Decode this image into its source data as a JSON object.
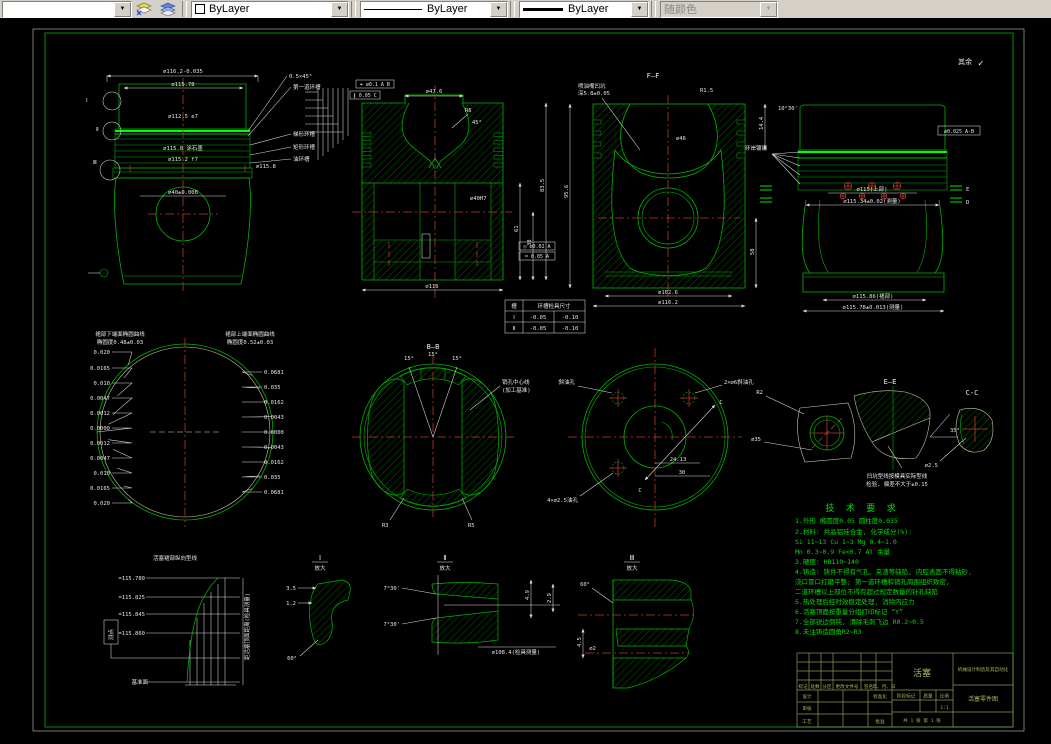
{
  "toolbar": {
    "color": {
      "value": "ByLayer"
    },
    "linetype": {
      "value": "ByLayer"
    },
    "lineweight": {
      "value": "ByLayer"
    },
    "plotstyle": {
      "value": "随颜色"
    }
  },
  "drawing": {
    "surface_note": "其余",
    "check": "✓",
    "front_view": {
      "dims": {
        "d1": "⌀116.2-0.035",
        "d2": "⌀115.78",
        "d3": "⌀112.5 e7",
        "d4": "⌀115.8 涂石墨",
        "d5": "⌀115.2 f7",
        "d6": "⌀40±0.008",
        "side": "⌀115.8"
      },
      "leaders": [
        "0.5×45°",
        "第一道环槽",
        "梯形环槽",
        "矩形环槽",
        "油环槽"
      ],
      "markers": [
        "Ⅰ",
        "Ⅱ",
        "Ⅲ"
      ]
    },
    "section_a": {
      "dims": {
        "top": "⌀47.6",
        "r6": "R6",
        "ang": "45°",
        "bore": "⌀40H7",
        "v1": "61",
        "v2": "38",
        "v3": "83.5",
        "b1": "⌀116"
      },
      "fcf": [
        "⌖ ⌀0.1 A B",
        "∥ 0.05 C",
        "◎ ⌀0.02 A",
        "= 0.05 A"
      ],
      "table": {
        "c0": "槽",
        "c1": "环槽检具尺寸",
        "r1": [
          "Ⅰ",
          "-0.05",
          "-0.10"
        ],
        "r2": [
          "Ⅱ",
          "-0.05",
          "-0.10"
        ]
      }
    },
    "section_f": {
      "label": "F—F",
      "dims": {
        "left": "95.6",
        "right1": "58",
        "right2": "14.4",
        "b1": "⌀102.6",
        "b2": "⌀116.2",
        "mid": "⌀46",
        "r": "R1.5"
      },
      "leader1": "喷油嘴凹坑",
      "leader2": "深5.8±0.05"
    },
    "skirt_view": {
      "dims": {
        "m1": "⌀115(上部)",
        "m2": "⌀115.34±0.02(测量)",
        "b1": "⌀115.86(裙部)",
        "b2": "⌀115.78±0.013(测量)",
        "angle": "10°30'",
        "datum": "⌀0.025 A-B",
        "coat": "环岸镀锡",
        "e": "E",
        "d": "D"
      }
    },
    "ovality": {
      "title_left": "裙部下端面椭圆曲线",
      "sub_left": "椭圆度0.48±0.03",
      "title_right": "裙部上端面椭圆曲线",
      "sub_right": "椭圆度0.52±0.03",
      "left": [
        "0.020",
        "0.0165",
        "0.010",
        "0.0047",
        "0.0012",
        "0.0000",
        "0.0012",
        "0.0047",
        "0.010",
        "0.0165",
        "0.020"
      ],
      "right": [
        "0.0681",
        "0.035",
        "0.0162",
        "0.0043",
        "0.0000",
        "0.0043",
        "0.0162",
        "0.035",
        "0.0681"
      ]
    },
    "section_b": {
      "label": "B—B",
      "angles": [
        "15°",
        "15°",
        "15°"
      ],
      "pin1": "销孔中心线",
      "pin2": "(加工基准)",
      "r1": "R3",
      "r2": "R5"
    },
    "bottom_view": {
      "leader_tl": "斜油孔",
      "leader_tr": "2×⌀6斜油孔",
      "leader_bl": "4×⌀2.5油孔",
      "d1": "24.13",
      "d2": "30",
      "c": "C"
    },
    "detail_d": {
      "r1": "R2",
      "r2": "⌀35"
    },
    "detail_e": {
      "label": "E—E",
      "angle": "35°",
      "note1": "凹坑型线按模具实际型线",
      "note2": "检验, 偏差不大于±0.15"
    },
    "detail_c": {
      "label": "C-C",
      "d1": "⌀2.5"
    },
    "det1": {
      "name": "Ⅰ",
      "sub": "放大",
      "d1": "3.5",
      "d2": "1.2",
      "d3": "60°"
    },
    "det2": {
      "name": "Ⅱ",
      "sub": "放大",
      "a1": "7°30'",
      "a2": "7°30'",
      "v1": "4.9",
      "v2": "2.9",
      "b": "⌀108.4(检具测量)"
    },
    "det3": {
      "name": "Ⅲ",
      "sub": "放大",
      "a1": "60°",
      "v1": "4.5",
      "d1": "⌀2"
    },
    "skirt_curve": {
      "title": "活塞裙部纵向型线",
      "values": [
        "=115.780",
        "=115.825",
        "=115.845",
        "=115.860"
      ],
      "base": "基准面",
      "box": "测点",
      "side": "距活塞顶面距离(检具测量)"
    },
    "tech": {
      "title": "技 术 要 求",
      "lines": [
        "1.外形  椭圆度0.05  圆柱度0.035",
        "2.材料: 共晶铝硅合金, 化学成分(%):",
        "      Si 11~13   Cu 1~3   Mg 0.4~1.0",
        "      Mn 0.3~0.9  Fe<0.7   Al 余量",
        "3.硬度: HB110~140",
        "4.铸造: 铸件不得有气孔、夹渣等缺陷, 内腔表面不得粘砂,",
        "    浇口冒口打磨平整; 第一道环槽和销孔周围组织致密,",
        "    二道环槽以上部位不得有超过规定数量的针孔缺陷",
        "5.热处理后经时效稳定处理, 消除内应力",
        "6.活塞顶面按重量分组打印标记 “Y”",
        "7.全部锐边倒钝, 清除毛刺飞边 R0.2~0.5",
        "8.未注铸造圆角R2~R3"
      ]
    },
    "title_block": {
      "rev_cols": [
        "标记",
        "处数",
        "分区",
        "更改文件号",
        "签名",
        "年、月、日"
      ],
      "roles": {
        "r1": "设计",
        "r2": "审核",
        "r3": "工艺",
        "s1": "标准化",
        "s2": "批准"
      },
      "part": "活塞",
      "stage": "阶段标记",
      "mass": "质量",
      "scale": "比例",
      "scale_val": "1:1",
      "sheet": "共 1 张 第 1 张",
      "org": "机械设计制造及其自动化",
      "doc": "活塞零件图"
    }
  }
}
